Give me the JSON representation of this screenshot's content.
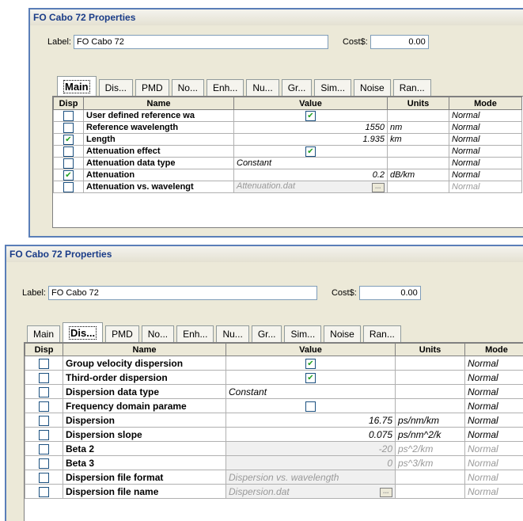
{
  "colors": {
    "title_text": "#1a3c88",
    "frame": "#5a7eb8",
    "dialog_bg": "#ece9d8"
  },
  "dialog1": {
    "title": "FO Cabo 72 Properties",
    "label_text": "Label:",
    "label_value": "FO Cabo 72",
    "cost_text": "Cost$:",
    "cost_value": "0.00",
    "tabs": [
      "Main",
      "Dis...",
      "PMD",
      "No...",
      "Enh...",
      "Nu...",
      "Gr...",
      "Sim...",
      "Noise",
      "Ran..."
    ],
    "active_tab": "Main",
    "columns": {
      "disp": "Disp",
      "name": "Name",
      "value": "Value",
      "units": "Units",
      "mode": "Mode"
    },
    "rows": [
      {
        "disp": false,
        "name": "User defined reference wa",
        "value": "",
        "units": "",
        "mode": "Normal"
      },
      {
        "disp": false,
        "name": "Reference wavelength",
        "value": "1550",
        "units": "nm",
        "mode": "Normal"
      },
      {
        "disp": true,
        "name": "Length",
        "value": "1.935",
        "units": "km",
        "mode": "Normal"
      },
      {
        "disp": false,
        "name": "Attenuation effect",
        "value": "",
        "units": "",
        "mode": "Normal"
      },
      {
        "disp": false,
        "name": "Attenuation data type",
        "value": "Constant",
        "units": "",
        "mode": "Normal"
      },
      {
        "disp": true,
        "name": "Attenuation",
        "value": "0.2",
        "units": "dB/km",
        "mode": "Normal"
      },
      {
        "disp": false,
        "name": "Attenuation vs. wavelengt",
        "value": "Attenuation.dat",
        "units": "",
        "mode": "Normal"
      }
    ]
  },
  "dialog2": {
    "title": "FO Cabo 72 Properties",
    "label_text": "Label:",
    "label_value": "FO Cabo 72",
    "cost_text": "Cost$:",
    "cost_value": "0.00",
    "tabs": [
      "Main",
      "Dis...",
      "PMD",
      "No...",
      "Enh...",
      "Nu...",
      "Gr...",
      "Sim...",
      "Noise",
      "Ran..."
    ],
    "active_tab": "Dis...",
    "columns": {
      "disp": "Disp",
      "name": "Name",
      "value": "Value",
      "units": "Units",
      "mode": "Mode"
    },
    "rows": [
      {
        "disp": false,
        "name": "Group velocity dispersion",
        "value": "",
        "units": "",
        "mode": "Normal"
      },
      {
        "disp": false,
        "name": "Third-order dispersion",
        "value": "",
        "units": "",
        "mode": "Normal"
      },
      {
        "disp": false,
        "name": "Dispersion data type",
        "value": "Constant",
        "units": "",
        "mode": "Normal"
      },
      {
        "disp": false,
        "name": "Frequency domain parame",
        "value": "",
        "units": "",
        "mode": "Normal"
      },
      {
        "disp": false,
        "name": "Dispersion",
        "value": "16.75",
        "units": "ps/nm/km",
        "mode": "Normal"
      },
      {
        "disp": false,
        "name": "Dispersion slope",
        "value": "0.075",
        "units": "ps/nm^2/k",
        "mode": "Normal"
      },
      {
        "disp": false,
        "name": "Beta 2",
        "value": "-20",
        "units": "ps^2/km",
        "mode": "Normal"
      },
      {
        "disp": false,
        "name": "Beta 3",
        "value": "0",
        "units": "ps^3/km",
        "mode": "Normal"
      },
      {
        "disp": false,
        "name": "Dispersion file format",
        "value": "Dispersion vs. wavelength",
        "units": "",
        "mode": "Normal"
      },
      {
        "disp": false,
        "name": "Dispersion file name",
        "value": "Dispersion.dat",
        "units": "",
        "mode": "Normal"
      }
    ]
  }
}
